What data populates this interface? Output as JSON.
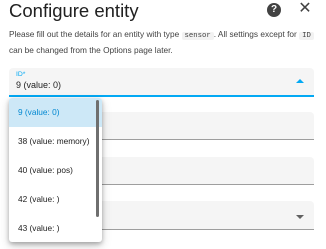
{
  "dialog": {
    "title": "Configure entity",
    "desc_pre": "Please fill out the details for an entity with type ",
    "desc_code1": "sensor",
    "desc_mid": ". All settings except for ",
    "desc_code2": "ID",
    "desc_post": " can be changed from the Options page later."
  },
  "icons": {
    "help": "?",
    "close": "✕"
  },
  "id_field": {
    "label": "ID*",
    "value": "9 (value: 0)"
  },
  "dropdown": {
    "options": [
      "9 (value: 0)",
      "38 (value: memory)",
      "40 (value: pos)",
      "42 (value: )",
      "43 (value: )"
    ]
  },
  "colors": {
    "accent": "#03a9f4",
    "selected_bg": "#cde8f7"
  }
}
